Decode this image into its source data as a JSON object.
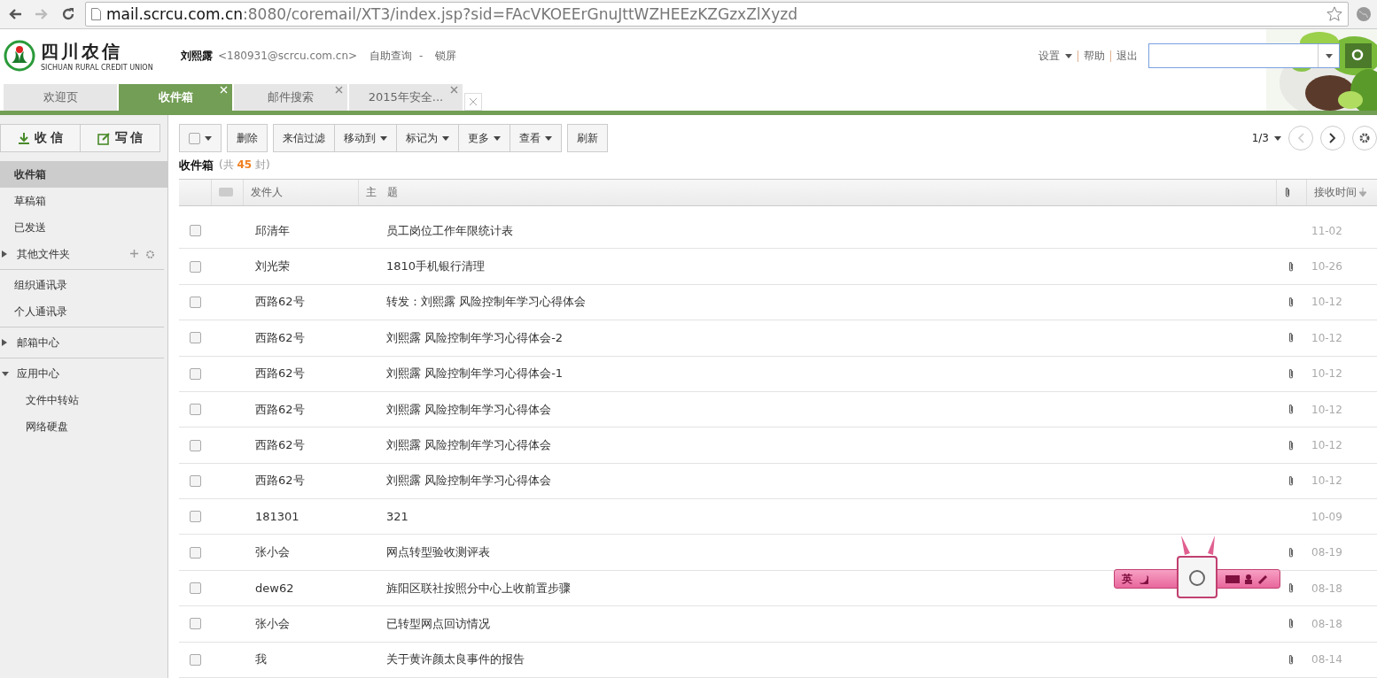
{
  "browser": {
    "url_host": "mail.scrcu.com.cn",
    "url_rest": ":8080/coremail/XT3/index.jsp?sid=FAcVKOEErGnuJttWZHEEzKZGzxZlXyzd"
  },
  "header": {
    "logo_cn": "四川农信",
    "logo_en": "SICHUAN RURAL CREDIT UNION",
    "user_name": "刘熙露",
    "user_email": "<180931@scrcu.com.cn>",
    "links": [
      "自助查询",
      "-",
      "锁屏"
    ],
    "right_links": [
      "设置",
      "帮助",
      "退出"
    ]
  },
  "tabs": [
    {
      "label": "欢迎页",
      "selected": false,
      "closable": false
    },
    {
      "label": "收件箱",
      "selected": true,
      "closable": true
    },
    {
      "label": "邮件搜索",
      "selected": false,
      "closable": true
    },
    {
      "label": "2015年安全...",
      "selected": false,
      "closable": true
    }
  ],
  "sidebar": {
    "receive": "收 信",
    "compose": "写 信",
    "groups": [
      {
        "items": [
          {
            "label": "收件箱",
            "selected": true
          },
          {
            "label": "草稿箱",
            "selected": false
          },
          {
            "label": "已发送",
            "selected": false
          },
          {
            "label": "其他文件夹",
            "selected": false,
            "expanded": false,
            "tools": true
          }
        ]
      },
      {
        "items": [
          {
            "label": "组织通讯录",
            "selected": false
          },
          {
            "label": "个人通讯录",
            "selected": false
          }
        ]
      },
      {
        "items": [
          {
            "label": "邮箱中心",
            "selected": false,
            "expanded": false
          }
        ]
      },
      {
        "items": [
          {
            "label": "应用中心",
            "selected": false,
            "expanded": true,
            "children": [
              {
                "label": "文件中转站",
                "selected": false
              },
              {
                "label": "网络硬盘",
                "selected": false
              }
            ]
          }
        ]
      }
    ]
  },
  "toolbar": {
    "groups": [
      [
        {
          "label": "删除",
          "menu": false
        }
      ],
      [
        {
          "label": "来信过滤",
          "menu": false
        },
        {
          "label": "移动到",
          "menu": true
        },
        {
          "label": "标记为",
          "menu": true
        },
        {
          "label": "更多",
          "menu": true
        },
        {
          "label": "查看",
          "menu": true
        }
      ],
      [
        {
          "label": "刷新",
          "menu": false
        }
      ]
    ],
    "page": "1/3"
  },
  "folder": {
    "title": "收件箱",
    "count_prefix": "(共",
    "count": "45",
    "count_suffix": "封)"
  },
  "columns": {
    "sender": "发件人",
    "subject": "主　题",
    "time": "接收时间"
  },
  "rows": [
    {
      "sender": "邱清年",
      "subject": "员工岗位工作年限统计表",
      "attachment": false,
      "time": "11-02",
      "checked": false
    },
    {
      "sender": "刘光荣",
      "subject": "1810手机银行清理",
      "attachment": true,
      "time": "10-26",
      "checked": false
    },
    {
      "sender": "西路62号",
      "subject": "转发：刘熙露 风险控制年学习心得体会",
      "attachment": true,
      "time": "10-12",
      "checked": false
    },
    {
      "sender": "西路62号",
      "subject": "刘熙露 风险控制年学习心得体会-2",
      "attachment": true,
      "time": "10-12",
      "checked": false
    },
    {
      "sender": "西路62号",
      "subject": "刘熙露 风险控制年学习心得体会-1",
      "attachment": true,
      "time": "10-12",
      "checked": false
    },
    {
      "sender": "西路62号",
      "subject": "刘熙露 风险控制年学习心得体会",
      "attachment": true,
      "time": "10-12",
      "checked": false
    },
    {
      "sender": "西路62号",
      "subject": "刘熙露 风险控制年学习心得体会",
      "attachment": true,
      "time": "10-12",
      "checked": false
    },
    {
      "sender": "西路62号",
      "subject": "刘熙露 风险控制年学习心得体会",
      "attachment": true,
      "time": "10-12",
      "checked": false
    },
    {
      "sender": "181301",
      "subject": "321",
      "attachment": false,
      "time": "10-09",
      "checked": false
    },
    {
      "sender": "张小会",
      "subject": "网点转型验收测评表",
      "attachment": true,
      "time": "08-19",
      "checked": false
    },
    {
      "sender": "dew62",
      "subject": "旌阳区联社按照分中心上收前置步骤",
      "attachment": true,
      "time": "08-18",
      "checked": false
    },
    {
      "sender": "张小会",
      "subject": "已转型网点回访情况",
      "attachment": true,
      "time": "08-18",
      "checked": false
    },
    {
      "sender": "我",
      "subject": "关于黄许颜太良事件的报告",
      "attachment": true,
      "time": "08-14",
      "checked": false
    }
  ],
  "ime": {
    "mode": "英"
  }
}
